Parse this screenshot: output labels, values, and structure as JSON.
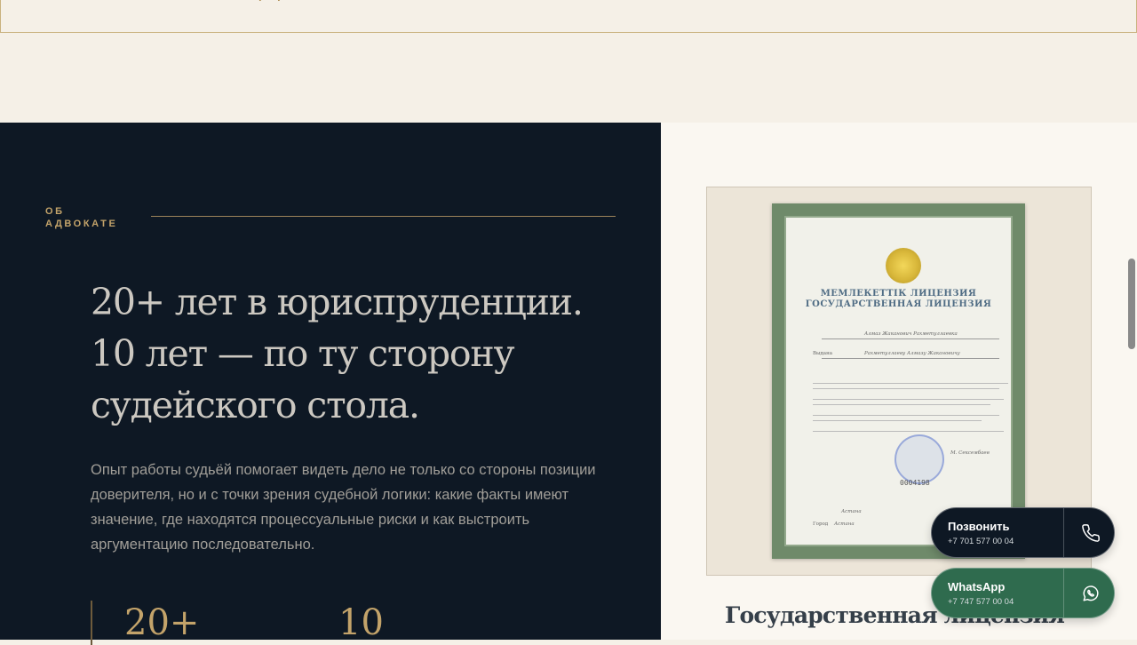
{
  "header": {
    "partial_glyph": "Д"
  },
  "about": {
    "section_label": "ОБ АДВОКАТЕ",
    "heading_lines": [
      "20+ лет в юриспруденции.",
      "10 лет — по ту сторону",
      "судейского стола."
    ],
    "description": "Опыт работы судьёй помогает видеть дело не только со стороны позиции доверителя, но и с точки зрения судебной логики: какие факты имеют значение, где находятся процессуальные риски и как выстроить аргументацию последовательно.",
    "stats": [
      "20+",
      "10"
    ]
  },
  "document": {
    "caption": "Государственная лицензия",
    "certificate": {
      "title_kz": "МЕМЛЕКЕТТІК ЛИЦЕНЗИЯ",
      "title_ru": "ГОСУДАРСТВЕННАЯ ЛИЦЕНЗИЯ",
      "holder_kz": "Алмаз Жаканович Рахметуллаевка",
      "issued_label": "Выдана",
      "holder_ru": "Рахметуллаеву Алмазу Жакановичу",
      "signatory": "М. Сексембаев",
      "number": "0004198",
      "city": "Астана",
      "city_label": "Город"
    }
  },
  "contact_buttons": [
    {
      "title": "Позвонить",
      "phone": "+7 701 577 00 04",
      "icon": "phone-icon"
    },
    {
      "title": "WhatsApp",
      "phone": "+7 747 577 00 04",
      "icon": "whatsapp-icon"
    }
  ],
  "colors": {
    "dark_bg": "#0e1824",
    "gold_accent": "#c3a36a",
    "cream_bg": "#f5f0e7",
    "whatsapp_green": "#2f6b4e"
  }
}
